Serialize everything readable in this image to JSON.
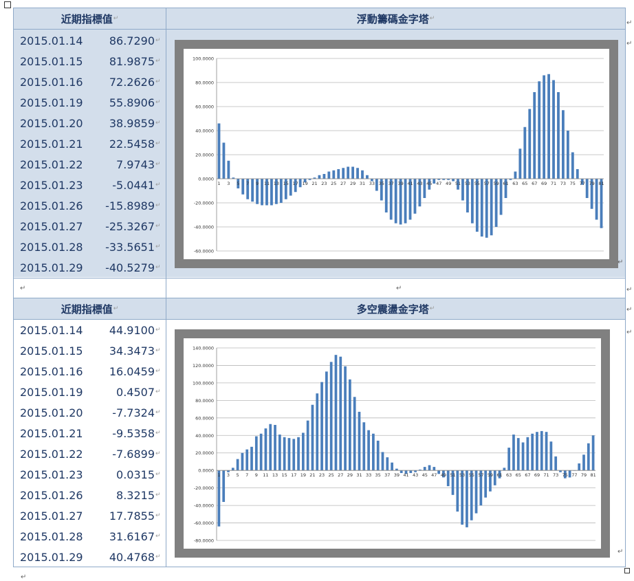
{
  "table1": {
    "left_header": "近期指標值",
    "right_header": "浮動籌碼金字塔",
    "rows": [
      {
        "date": "2015.01.14",
        "value": "86.7290"
      },
      {
        "date": "2015.01.15",
        "value": "81.9875"
      },
      {
        "date": "2015.01.16",
        "value": "72.2626"
      },
      {
        "date": "2015.01.19",
        "value": "55.8906"
      },
      {
        "date": "2015.01.20",
        "value": "38.9859"
      },
      {
        "date": "2015.01.21",
        "value": "22.5458"
      },
      {
        "date": "2015.01.22",
        "value": "7.9743"
      },
      {
        "date": "2015.01.23",
        "value": "-5.0441"
      },
      {
        "date": "2015.01.26",
        "value": "-15.8989"
      },
      {
        "date": "2015.01.27",
        "value": "-25.3267"
      },
      {
        "date": "2015.01.28",
        "value": "-33.5651"
      },
      {
        "date": "2015.01.29",
        "value": "-40.5279"
      }
    ]
  },
  "table2": {
    "left_header": "近期指標值",
    "right_header": "多空震盪金字塔",
    "rows": [
      {
        "date": "2015.01.14",
        "value": "44.9100"
      },
      {
        "date": "2015.01.15",
        "value": "34.3473"
      },
      {
        "date": "2015.01.16",
        "value": "16.0459"
      },
      {
        "date": "2015.01.19",
        "value": "0.4507"
      },
      {
        "date": "2015.01.20",
        "value": "-7.7324"
      },
      {
        "date": "2015.01.21",
        "value": "-9.5358"
      },
      {
        "date": "2015.01.22",
        "value": "-7.6899"
      },
      {
        "date": "2015.01.23",
        "value": "0.0315"
      },
      {
        "date": "2015.01.26",
        "value": "8.3215"
      },
      {
        "date": "2015.01.27",
        "value": "17.7855"
      },
      {
        "date": "2015.01.28",
        "value": "31.6167"
      },
      {
        "date": "2015.01.29",
        "value": "40.4768"
      }
    ]
  },
  "colors": {
    "bar": "#4a7ebb",
    "header_bg": "#d3deeb",
    "text": "#1f3864",
    "chart_frame": "#808080"
  },
  "chart_data": [
    {
      "type": "bar",
      "ylim": [
        -60,
        100
      ],
      "yticks": [
        "100.0000",
        "80.0000",
        "60.0000",
        "40.0000",
        "20.0000",
        "0.0000",
        "-20.0000",
        "-40.0000",
        "-60.0000"
      ],
      "ytick_values": [
        100,
        80,
        60,
        40,
        20,
        0,
        -20,
        -40,
        -60
      ],
      "xtick_labels": [
        "1",
        "3",
        "5",
        "7",
        "9",
        "11",
        "13",
        "15",
        "17",
        "19",
        "21",
        "23",
        "25",
        "27",
        "29",
        "31",
        "33",
        "35",
        "37",
        "39",
        "41",
        "43",
        "45",
        "47",
        "49",
        "51",
        "53",
        "55",
        "57",
        "59",
        "61",
        "63",
        "65",
        "67",
        "69",
        "71",
        "73",
        "75",
        "77",
        "79",
        "81"
      ],
      "grid": true,
      "values": [
        46,
        30,
        15,
        1,
        -8,
        -13,
        -17,
        -19,
        -21,
        -22,
        -22,
        -22,
        -21,
        -20,
        -17,
        -14,
        -11,
        -7,
        -3,
        -1,
        1,
        3,
        4,
        6,
        7,
        8,
        9,
        10,
        10,
        9,
        7,
        3,
        -2,
        -10,
        -18,
        -28,
        -34,
        -37,
        -38,
        -37,
        -34,
        -29,
        -23,
        -16,
        -9,
        -4,
        -1,
        -1,
        -1,
        -2,
        -9,
        -18,
        -28,
        -37,
        -44,
        -48,
        -49,
        -47,
        -40,
        -30,
        -16,
        -1,
        6,
        25,
        43,
        58,
        72,
        81,
        86,
        87,
        82,
        72,
        57,
        40,
        22,
        8,
        -5,
        -16,
        -25,
        -34,
        -41
      ]
    },
    {
      "type": "bar",
      "ylim": [
        -80,
        140
      ],
      "yticks": [
        "140.0000",
        "120.0000",
        "100.0000",
        "80.0000",
        "60.0000",
        "40.0000",
        "20.0000",
        "0.0000",
        "-20.0000",
        "-40.0000",
        "-60.0000",
        "-80.0000"
      ],
      "ytick_values": [
        140,
        120,
        100,
        80,
        60,
        40,
        20,
        0,
        -20,
        -40,
        -60,
        -80
      ],
      "xtick_labels": [
        "1",
        "3",
        "5",
        "7",
        "9",
        "11",
        "13",
        "15",
        "17",
        "19",
        "21",
        "23",
        "25",
        "27",
        "29",
        "31",
        "33",
        "35",
        "37",
        "39",
        "41",
        "43",
        "45",
        "47",
        "49",
        "51",
        "53",
        "55",
        "57",
        "59",
        "61",
        "63",
        "65",
        "67",
        "69",
        "71",
        "73",
        "75",
        "77",
        "79",
        "81"
      ],
      "grid": true,
      "values": [
        -64,
        -36,
        -2,
        3,
        13,
        20,
        24,
        27,
        39,
        42,
        48,
        53,
        52,
        41,
        38,
        37,
        36,
        38,
        43,
        57,
        75,
        88,
        101,
        113,
        124,
        132,
        130,
        119,
        104,
        84,
        67,
        55,
        46,
        42,
        34,
        21,
        15,
        9,
        2,
        -3,
        -4,
        -3,
        -2,
        1,
        4,
        6,
        4,
        -4,
        -8,
        -18,
        -28,
        -47,
        -62,
        -65,
        -57,
        -49,
        -40,
        -31,
        -24,
        -17,
        -9,
        3,
        26,
        41,
        37,
        32,
        38,
        42,
        44,
        45,
        44,
        33,
        16,
        -2,
        -9,
        -8,
        0,
        8,
        18,
        31,
        40
      ]
    }
  ]
}
